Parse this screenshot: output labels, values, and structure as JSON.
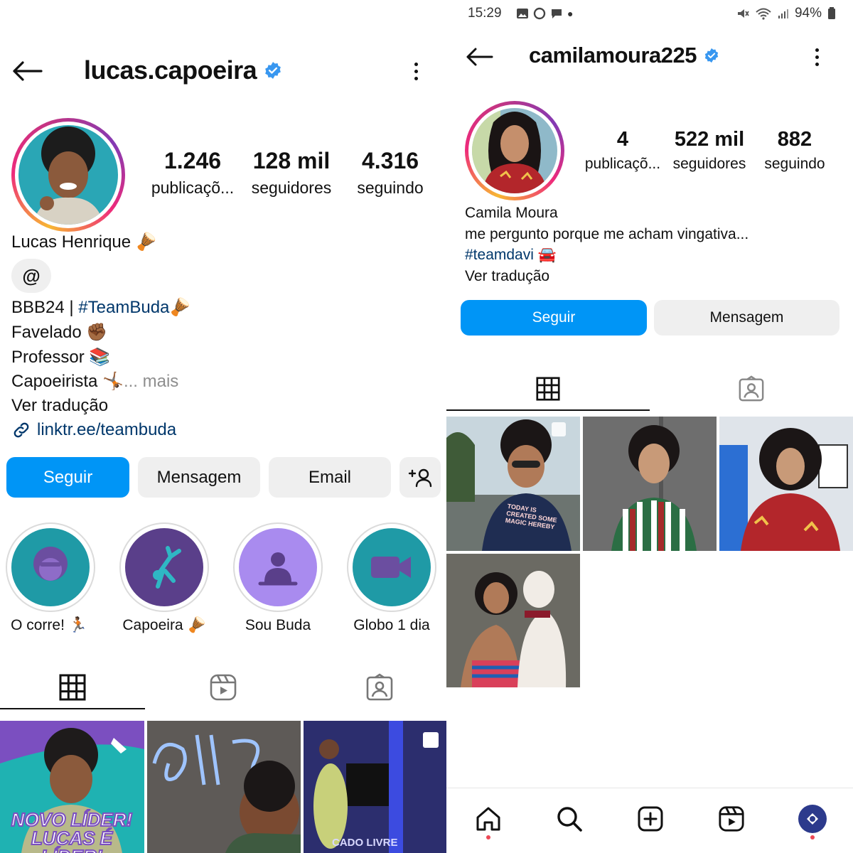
{
  "left": {
    "username": "lucas.capoeira",
    "stats": [
      {
        "value": "1.246",
        "label": "publicaçõ..."
      },
      {
        "value": "128 mil",
        "label": "seguidores"
      },
      {
        "value": "4.316",
        "label": "seguindo"
      }
    ],
    "display_name": "Lucas Henrique 🪘",
    "bio": {
      "line1_prefix": "BBB24 | ",
      "line1_tag": "#TeamBuda🪘",
      "line2": "Favelado ✊🏾",
      "line3": "Professor 📚",
      "line4": "Capoeirista 🤸🏾",
      "more": "... mais",
      "translate": "Ver tradução",
      "link": "linktr.ee/teambuda"
    },
    "buttons": {
      "follow": "Seguir",
      "message": "Mensagem",
      "email": "Email"
    },
    "highlights": [
      {
        "label": "O corre! 🏃🏾",
        "color": "#1f9aa6"
      },
      {
        "label": "Capoeira 🪘",
        "color": "#5a3f8a"
      },
      {
        "label": "Sou Buda",
        "color": "#a98bef"
      },
      {
        "label": "Globo 1 dia",
        "color": "#1f9aa6"
      }
    ],
    "posts": [
      {
        "caption": "NOVO LÍDER! LUCAS É LÍDER!"
      },
      {
        "caption": ""
      },
      {
        "caption": "CADO LIVRE"
      }
    ]
  },
  "right": {
    "status": {
      "time": "15:29",
      "battery": "94%"
    },
    "username": "camilamoura225",
    "stats": [
      {
        "value": "4",
        "label": "publicaçõ..."
      },
      {
        "value": "522 mil",
        "label": "seguidores"
      },
      {
        "value": "882",
        "label": "seguindo"
      }
    ],
    "display_name": "Camila Moura",
    "bio_line": "me pergunto porque me acham vingativa...",
    "hashtag": "#teamdavi 🚘",
    "translate": "Ver tradução",
    "buttons": {
      "follow": "Seguir",
      "message": "Mensagem"
    },
    "post_text": "TODAY IS CREATED SOME MAGIC HEREBY"
  },
  "colors": {
    "primary": "#0095f6",
    "verified": "#3897f0",
    "link": "#00376b"
  }
}
